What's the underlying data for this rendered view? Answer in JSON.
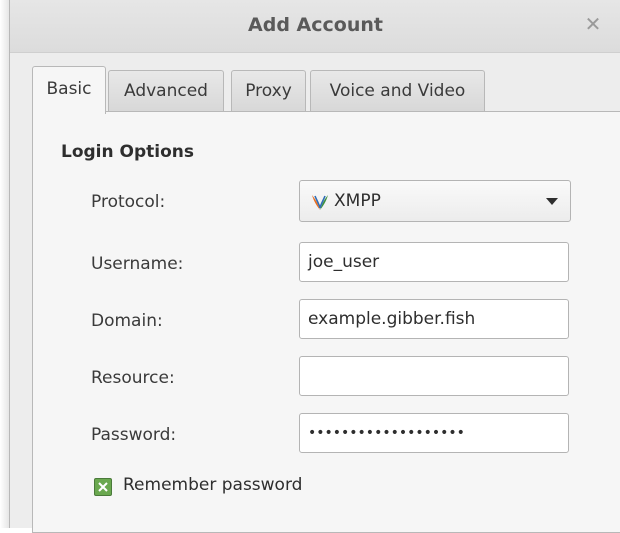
{
  "window": {
    "title": "Add Account",
    "close_glyph": "✕"
  },
  "tabs": [
    {
      "label": "Basic",
      "active": true
    },
    {
      "label": "Advanced",
      "active": false
    },
    {
      "label": "Proxy",
      "active": false
    },
    {
      "label": "Voice and Video",
      "active": false
    }
  ],
  "login": {
    "section_title": "Login Options",
    "protocol_label": "Protocol:",
    "protocol_value": "XMPP",
    "protocol_icon": "xmpp-logo-icon",
    "username_label": "Username:",
    "username_value": "joe_user",
    "domain_label": "Domain:",
    "domain_value": "example.gibber.fish",
    "resource_label": "Resource:",
    "resource_value": "",
    "password_label": "Password:",
    "password_masked": "•••••••••••••••••••",
    "remember_label": "Remember password",
    "remember_checked": true
  },
  "colors": {
    "checkbox_green": "#6aa84f",
    "xmpp_orange": "#e96d1f",
    "xmpp_green": "#3c8f3c"
  }
}
